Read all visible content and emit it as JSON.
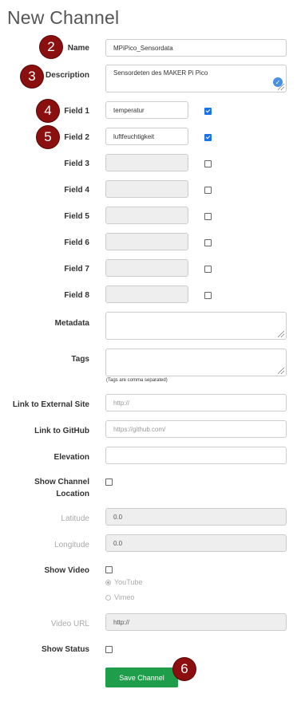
{
  "page": {
    "title": "New Channel"
  },
  "badges": {
    "b2": "2",
    "b3": "3",
    "b4": "4",
    "b5": "5",
    "b6": "6"
  },
  "form": {
    "name": {
      "label": "Name",
      "value": "MPiPico_Sensordata"
    },
    "description": {
      "label": "Description",
      "value": "Sensordeten des MAKER Pi Pico"
    },
    "fields": [
      {
        "label": "Field 1",
        "value": "temperatur",
        "checked": true
      },
      {
        "label": "Field 2",
        "value": "luftfeuchtigkeit",
        "checked": true
      },
      {
        "label": "Field 3",
        "value": "",
        "checked": false
      },
      {
        "label": "Field 4",
        "value": "",
        "checked": false
      },
      {
        "label": "Field 5",
        "value": "",
        "checked": false
      },
      {
        "label": "Field 6",
        "value": "",
        "checked": false
      },
      {
        "label": "Field 7",
        "value": "",
        "checked": false
      },
      {
        "label": "Field 8",
        "value": "",
        "checked": false
      }
    ],
    "metadata": {
      "label": "Metadata",
      "value": ""
    },
    "tags": {
      "label": "Tags",
      "value": "",
      "note": "(Tags are comma separated)"
    },
    "external_site": {
      "label": "Link to External Site",
      "placeholder": "http://"
    },
    "github": {
      "label": "Link to GitHub",
      "placeholder": "https://github.com/"
    },
    "elevation": {
      "label": "Elevation",
      "value": ""
    },
    "show_location": {
      "label_line1": "Show Channel",
      "label_line2": "Location",
      "checked": false
    },
    "latitude": {
      "label": "Latitude",
      "value": "0.0"
    },
    "longitude": {
      "label": "Longitude",
      "value": "0.0"
    },
    "show_video": {
      "label": "Show Video",
      "checked": false
    },
    "video_options": {
      "youtube": "YouTube",
      "vimeo": "Vimeo",
      "selected": "YouTube"
    },
    "video_url": {
      "label": "Video URL",
      "placeholder": "http://"
    },
    "show_status": {
      "label": "Show Status",
      "checked": false
    },
    "save_label": "Save Channel"
  },
  "colors": {
    "accent": "#1e9e4a",
    "badge": "#8b0f0f",
    "checkbox": "#1a73e8"
  }
}
